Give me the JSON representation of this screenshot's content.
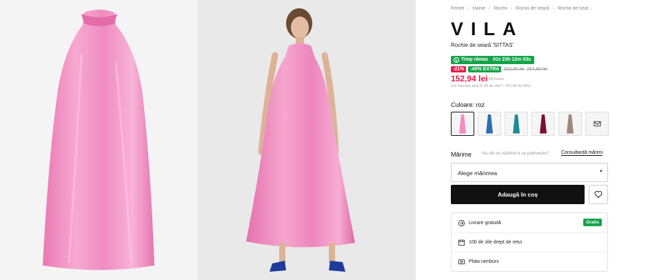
{
  "breadcrumbs": [
    "Femei",
    "Haine",
    "Rochii",
    "Rochii de seară",
    "Rochii de sear..."
  ],
  "product": {
    "brand": "VILA",
    "name": "Rochie de seară 'SITTAS'",
    "image_color": "#f08fc1"
  },
  "promo": {
    "timer_label": "Timp rămas",
    "timer_value": "01z 23h 12m 03s",
    "discount": "-21%",
    "extra": "-40% EXTRA",
    "old_price_1": "322,90 lei",
    "old_price_2": "254,90 lei",
    "price": "152,94 lei",
    "vat": "TVA inclus",
    "lowest_price": "Cel mai bun preț în 30 de zile**: 152,94 lei (0%)"
  },
  "color": {
    "label": "Culoare: roz",
    "swatches": [
      {
        "name": "roz",
        "hex": "#f08fc1",
        "active": true
      },
      {
        "name": "albastru",
        "hex": "#2a6fb0",
        "active": false
      },
      {
        "name": "petrol",
        "hex": "#1f8a9a",
        "active": false
      },
      {
        "name": "bordo",
        "hex": "#7a1030",
        "active": false
      },
      {
        "name": "taupe",
        "hex": "#a08878",
        "active": false
      }
    ],
    "notify_icon": "mail-icon"
  },
  "size": {
    "label": "Mărime",
    "question": "Nu știi ce mărime ți se potrivește?",
    "link": "Consultanță mărimi",
    "select_placeholder": "Alege mărimea"
  },
  "actions": {
    "add_to_cart": "Adaugă în coș"
  },
  "info": [
    {
      "icon": "delivery-icon",
      "text": "Livrare gratuită",
      "badge": "Gratis"
    },
    {
      "icon": "calendar-icon",
      "text": "100 de zile drept de retur",
      "badge": ""
    },
    {
      "icon": "cash-icon",
      "text": "Plata ramburs",
      "badge": ""
    }
  ],
  "colors": {
    "accent_green": "#15a34a",
    "sale_red": "#e11d48",
    "button_black": "#111111"
  }
}
